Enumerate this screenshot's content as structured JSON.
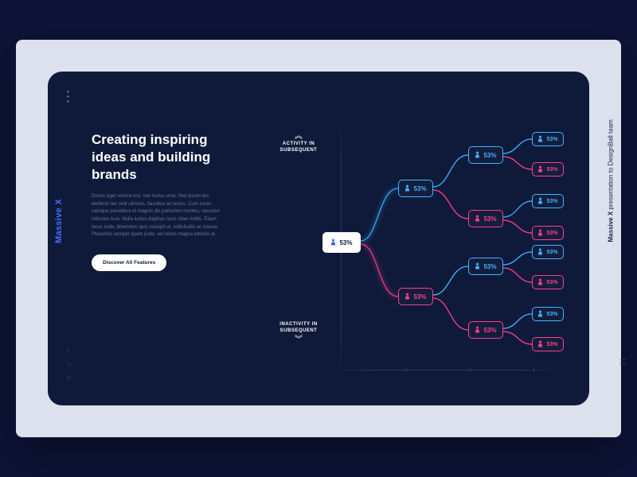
{
  "brand": "Massive X",
  "title": "Creating inspiring ideas and building brands",
  "desc": "Donec eget viverra nisi, non luctus urna. Sed ipsum leo, eleifend nec velit ultricies, faucibus ac lectus. Cum sociis natoque penatibus et magnis dis parturient montes, nascetur ridiculus mus. Nulla luctus dapibus nunc vitae mollis. Etiam lacus nulla, bibendum quis suscipit ut, sollicitudin ac massa. Phasellus semper quam justo, vel luctus magna lobortis at.",
  "cta": "Discover All Features",
  "labels": {
    "top": "ACTIVITY IN SUBSEQUENT",
    "bottom": "INACTIVITY IN SUBSEQUENT"
  },
  "footer": {
    "brand": "Massive X",
    "rest": " presentation to DesignBall team",
    "page": "21"
  },
  "chart_data": {
    "type": "tree",
    "root": {
      "value": "53%",
      "color": "white"
    },
    "level2": [
      {
        "value": "53%",
        "color": "blue",
        "y": "upper"
      },
      {
        "value": "53%",
        "color": "pink",
        "y": "lower"
      }
    ],
    "level3": [
      {
        "value": "53%",
        "color": "blue",
        "parent": 0
      },
      {
        "value": "53%",
        "color": "pink",
        "parent": 0
      },
      {
        "value": "53%",
        "color": "blue",
        "parent": 1
      },
      {
        "value": "53%",
        "color": "pink",
        "parent": 1
      }
    ],
    "level4": [
      {
        "value": "53%",
        "color": "blue"
      },
      {
        "value": "53%",
        "color": "pink"
      },
      {
        "value": "53%",
        "color": "blue"
      },
      {
        "value": "53%",
        "color": "pink"
      },
      {
        "value": "53%",
        "color": "blue"
      },
      {
        "value": "53%",
        "color": "pink"
      },
      {
        "value": "53%",
        "color": "blue"
      },
      {
        "value": "53%",
        "color": "pink"
      }
    ]
  }
}
